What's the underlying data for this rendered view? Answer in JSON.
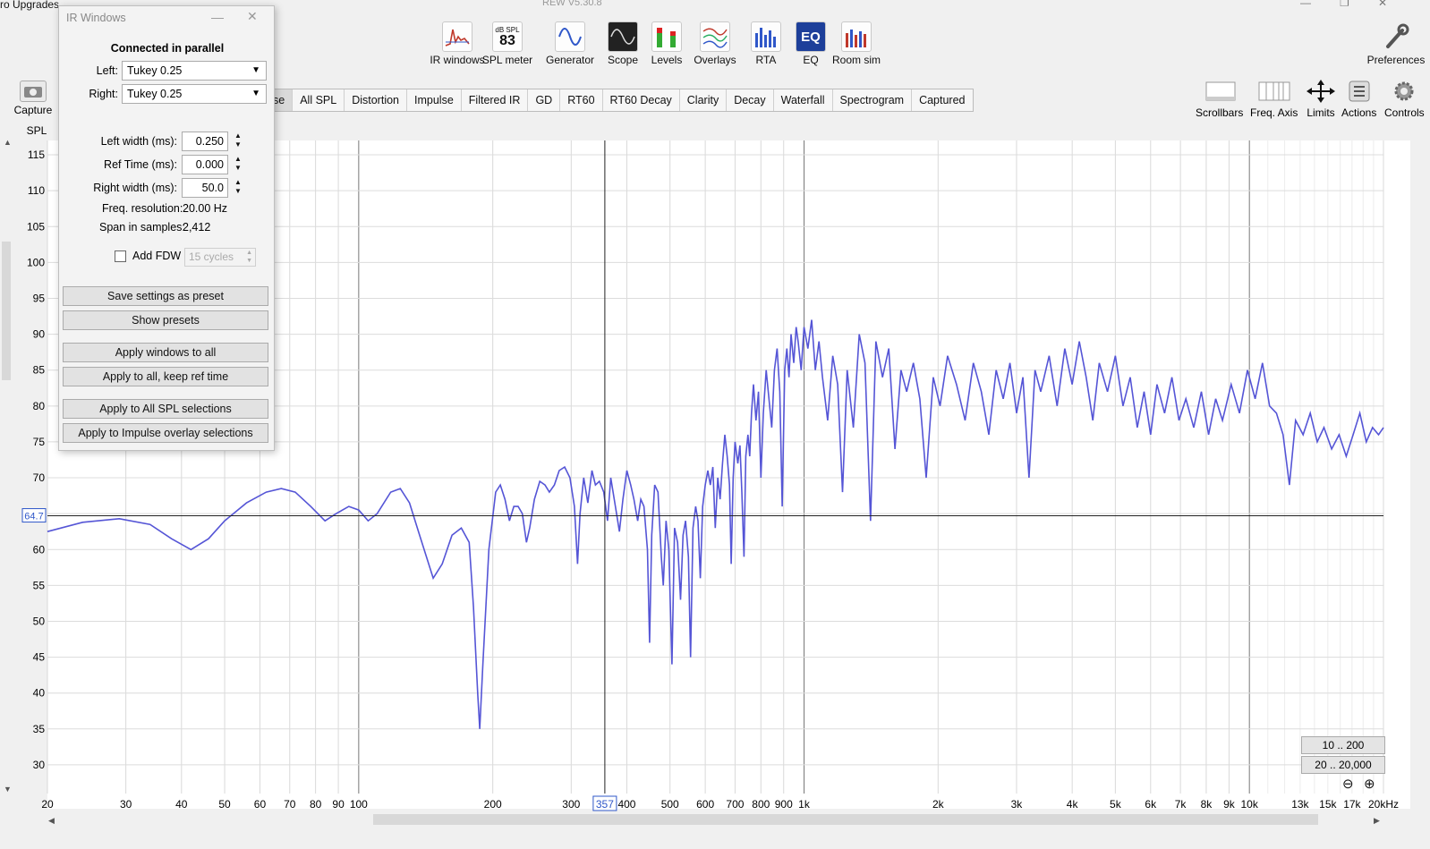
{
  "window": {
    "title": "ro Upgrades",
    "version": "REW V5.30.8",
    "controls": [
      "—",
      "❐",
      "✕"
    ]
  },
  "toolbar": [
    {
      "name": "ir-windows",
      "label": "IR windows",
      "icon": "ir-windows-icon"
    },
    {
      "name": "spl-meter",
      "label": "SPL meter",
      "icon": "spl-meter-icon",
      "meter_unit": "dB SPL",
      "meter_value": "83"
    },
    {
      "name": "generator",
      "label": "Generator",
      "icon": "generator-icon"
    },
    {
      "name": "scope",
      "label": "Scope",
      "icon": "scope-icon"
    },
    {
      "name": "levels",
      "label": "Levels",
      "icon": "levels-icon"
    },
    {
      "name": "overlays",
      "label": "Overlays",
      "icon": "overlays-icon"
    },
    {
      "name": "rta",
      "label": "RTA",
      "icon": "rta-icon"
    },
    {
      "name": "eq",
      "label": "EQ",
      "icon": "eq-icon"
    },
    {
      "name": "room-sim",
      "label": "Room sim",
      "icon": "room-sim-icon"
    },
    {
      "name": "preferences",
      "label": "Preferences",
      "icon": "wrench-icon"
    }
  ],
  "capture": {
    "label": "Capture"
  },
  "tabs": [
    {
      "label": "se",
      "active": true
    },
    {
      "label": "All SPL"
    },
    {
      "label": "Distortion"
    },
    {
      "label": "Impulse"
    },
    {
      "label": "Filtered IR"
    },
    {
      "label": "GD"
    },
    {
      "label": "RT60"
    },
    {
      "label": "RT60 Decay"
    },
    {
      "label": "Clarity"
    },
    {
      "label": "Decay"
    },
    {
      "label": "Waterfall"
    },
    {
      "label": "Spectrogram"
    },
    {
      "label": "Captured"
    }
  ],
  "graph_tools": [
    {
      "name": "scrollbars",
      "label": "Scrollbars"
    },
    {
      "name": "freq-axis",
      "label": "Freq. Axis"
    },
    {
      "name": "limits",
      "label": "Limits"
    },
    {
      "name": "actions",
      "label": "Actions"
    },
    {
      "name": "controls",
      "label": "Controls"
    }
  ],
  "ir_windows": {
    "title": "IR Windows",
    "mode": "Connected in parallel",
    "left_label": "Left:",
    "left_value": "Tukey 0.25",
    "right_label": "Right:",
    "right_value": "Tukey 0.25",
    "left_width_label": "Left width (ms):",
    "left_width": "0.250",
    "ref_time_label": "Ref Time (ms):",
    "ref_time": "0.000",
    "right_width_label": "Right width (ms):",
    "right_width": "50.0",
    "freq_res_label": "Freq. resolution:",
    "freq_res": "20.00 Hz",
    "span_label": "Span in samples:",
    "span": "2,412",
    "fdw_label": "Add FDW",
    "fdw_checked": false,
    "fdw_cycles": "15 cycles",
    "buttons": [
      "Save settings as preset",
      "Show presets",
      "Apply windows to all",
      "Apply to all, keep ref time",
      "Apply to All SPL selections",
      "Apply to Impulse overlay selections"
    ]
  },
  "range_buttons": [
    "10 .. 200",
    "20 .. 20,000"
  ],
  "chart_data": {
    "type": "line",
    "ylabel": "SPL",
    "xscale": "log",
    "xlim": [
      20,
      20000
    ],
    "ylim": [
      26,
      117
    ],
    "y_ticks": [
      30,
      35,
      40,
      45,
      50,
      55,
      60,
      65,
      70,
      75,
      80,
      85,
      90,
      95,
      100,
      105,
      110,
      115
    ],
    "x_ticks": [
      {
        "v": 20,
        "l": "20"
      },
      {
        "v": 30,
        "l": "30"
      },
      {
        "v": 40,
        "l": "40"
      },
      {
        "v": 50,
        "l": "50"
      },
      {
        "v": 60,
        "l": "60"
      },
      {
        "v": 70,
        "l": "70"
      },
      {
        "v": 80,
        "l": "80"
      },
      {
        "v": 90,
        "l": "90"
      },
      {
        "v": 100,
        "l": "100"
      },
      {
        "v": 200,
        "l": "200"
      },
      {
        "v": 300,
        "l": "300"
      },
      {
        "v": 400,
        "l": "400"
      },
      {
        "v": 500,
        "l": "500"
      },
      {
        "v": 600,
        "l": "600"
      },
      {
        "v": 700,
        "l": "700"
      },
      {
        "v": 800,
        "l": "800"
      },
      {
        "v": 900,
        "l": "900"
      },
      {
        "v": 1000,
        "l": "1k"
      },
      {
        "v": 2000,
        "l": "2k"
      },
      {
        "v": 3000,
        "l": "3k"
      },
      {
        "v": 4000,
        "l": "4k"
      },
      {
        "v": 5000,
        "l": "5k"
      },
      {
        "v": 6000,
        "l": "6k"
      },
      {
        "v": 7000,
        "l": "7k"
      },
      {
        "v": 8000,
        "l": "8k"
      },
      {
        "v": 9000,
        "l": "9k"
      },
      {
        "v": 10000,
        "l": "10k"
      },
      {
        "v": 13000,
        "l": "13k"
      },
      {
        "v": 15000,
        "l": "15k"
      },
      {
        "v": 17000,
        "l": "17k"
      },
      {
        "v": 20000,
        "l": "20kHz"
      }
    ],
    "cursor": {
      "freq": 357,
      "freq_label": "357",
      "spl": 64.7,
      "spl_label": "64.7"
    },
    "line_color": "#5555d6",
    "series": [
      {
        "points": [
          [
            20,
            62.5
          ],
          [
            24,
            63.8
          ],
          [
            29,
            64.3
          ],
          [
            34,
            63.5
          ],
          [
            38,
            61.5
          ],
          [
            42,
            60
          ],
          [
            46,
            61.5
          ],
          [
            50,
            64
          ],
          [
            56,
            66.5
          ],
          [
            62,
            68
          ],
          [
            67,
            68.5
          ],
          [
            72,
            68
          ],
          [
            78,
            66
          ],
          [
            84,
            64
          ],
          [
            89,
            65
          ],
          [
            95,
            66
          ],
          [
            100,
            65.5
          ],
          [
            105,
            64
          ],
          [
            110,
            65
          ],
          [
            118,
            68
          ],
          [
            124,
            68.5
          ],
          [
            130,
            66.5
          ],
          [
            137,
            62
          ],
          [
            147,
            56
          ],
          [
            154,
            58
          ],
          [
            162,
            62
          ],
          [
            170,
            63
          ],
          [
            177,
            61
          ],
          [
            181,
            52
          ],
          [
            185,
            40
          ],
          [
            187,
            35
          ],
          [
            190,
            44
          ],
          [
            196,
            60
          ],
          [
            203,
            68
          ],
          [
            208,
            69
          ],
          [
            213,
            67
          ],
          [
            218,
            64
          ],
          [
            223,
            66
          ],
          [
            228,
            66
          ],
          [
            233,
            65
          ],
          [
            238,
            61
          ],
          [
            242,
            63
          ],
          [
            248,
            67
          ],
          [
            255,
            69.5
          ],
          [
            262,
            69
          ],
          [
            268,
            68
          ],
          [
            275,
            69
          ],
          [
            282,
            71
          ],
          [
            290,
            71.5
          ],
          [
            298,
            70
          ],
          [
            305,
            66
          ],
          [
            310,
            58
          ],
          [
            314,
            65
          ],
          [
            320,
            70
          ],
          [
            327,
            66.5
          ],
          [
            334,
            71
          ],
          [
            340,
            69
          ],
          [
            347,
            69.5
          ],
          [
            355,
            68
          ],
          [
            362,
            64
          ],
          [
            368,
            70
          ],
          [
            377,
            66
          ],
          [
            385,
            62.5
          ],
          [
            392,
            67
          ],
          [
            400,
            71
          ],
          [
            408,
            69
          ],
          [
            415,
            67
          ],
          [
            423,
            64
          ],
          [
            430,
            67
          ],
          [
            437,
            66
          ],
          [
            445,
            60
          ],
          [
            450,
            47
          ],
          [
            455,
            62
          ],
          [
            462,
            69
          ],
          [
            470,
            68
          ],
          [
            478,
            59
          ],
          [
            483,
            55
          ],
          [
            490,
            64
          ],
          [
            497,
            60
          ],
          [
            505,
            44
          ],
          [
            512,
            63
          ],
          [
            520,
            61
          ],
          [
            528,
            53
          ],
          [
            535,
            62
          ],
          [
            542,
            64
          ],
          [
            550,
            59
          ],
          [
            556,
            45
          ],
          [
            563,
            63
          ],
          [
            571,
            66
          ],
          [
            578,
            64
          ],
          [
            585,
            56
          ],
          [
            592,
            66
          ],
          [
            600,
            69
          ],
          [
            608,
            71
          ],
          [
            616,
            69
          ],
          [
            624,
            71.5
          ],
          [
            632,
            63
          ],
          [
            640,
            70
          ],
          [
            648,
            67
          ],
          [
            656,
            72
          ],
          [
            664,
            76
          ],
          [
            672,
            73
          ],
          [
            680,
            69
          ],
          [
            686,
            58
          ],
          [
            693,
            70
          ],
          [
            700,
            75
          ],
          [
            710,
            72
          ],
          [
            718,
            74.5
          ],
          [
            725,
            68
          ],
          [
            733,
            59
          ],
          [
            740,
            73
          ],
          [
            748,
            76
          ],
          [
            755,
            73
          ],
          [
            762,
            79
          ],
          [
            770,
            83
          ],
          [
            780,
            78
          ],
          [
            790,
            82
          ],
          [
            800,
            70
          ],
          [
            810,
            79
          ],
          [
            822,
            85
          ],
          [
            834,
            81
          ],
          [
            846,
            77
          ],
          [
            858,
            85
          ],
          [
            870,
            88
          ],
          [
            882,
            82
          ],
          [
            893,
            66
          ],
          [
            905,
            85
          ],
          [
            915,
            88
          ],
          [
            925,
            84
          ],
          [
            935,
            90
          ],
          [
            948,
            86
          ],
          [
            960,
            91
          ],
          [
            970,
            89
          ],
          [
            985,
            85
          ],
          [
            1000,
            91
          ],
          [
            1020,
            88
          ],
          [
            1040,
            92
          ],
          [
            1060,
            85
          ],
          [
            1080,
            89
          ],
          [
            1100,
            84
          ],
          [
            1130,
            78
          ],
          [
            1160,
            87
          ],
          [
            1190,
            83
          ],
          [
            1220,
            68
          ],
          [
            1250,
            85
          ],
          [
            1290,
            77
          ],
          [
            1330,
            90
          ],
          [
            1370,
            86
          ],
          [
            1410,
            64
          ],
          [
            1450,
            89
          ],
          [
            1500,
            84
          ],
          [
            1550,
            88
          ],
          [
            1600,
            74
          ],
          [
            1650,
            85
          ],
          [
            1700,
            82
          ],
          [
            1760,
            86
          ],
          [
            1820,
            81
          ],
          [
            1880,
            70
          ],
          [
            1950,
            84
          ],
          [
            2020,
            80
          ],
          [
            2100,
            87
          ],
          [
            2200,
            83
          ],
          [
            2300,
            78
          ],
          [
            2400,
            86
          ],
          [
            2500,
            82
          ],
          [
            2600,
            76
          ],
          [
            2700,
            85
          ],
          [
            2800,
            81
          ],
          [
            2900,
            86
          ],
          [
            3000,
            79
          ],
          [
            3100,
            84
          ],
          [
            3200,
            70
          ],
          [
            3300,
            85
          ],
          [
            3400,
            82
          ],
          [
            3550,
            87
          ],
          [
            3700,
            80
          ],
          [
            3850,
            88
          ],
          [
            4000,
            83
          ],
          [
            4150,
            89
          ],
          [
            4300,
            84
          ],
          [
            4450,
            78
          ],
          [
            4600,
            86
          ],
          [
            4800,
            82
          ],
          [
            5000,
            87
          ],
          [
            5200,
            80
          ],
          [
            5400,
            84
          ],
          [
            5600,
            77
          ],
          [
            5800,
            82
          ],
          [
            6000,
            76
          ],
          [
            6200,
            83
          ],
          [
            6450,
            79
          ],
          [
            6700,
            84
          ],
          [
            6950,
            78
          ],
          [
            7200,
            81
          ],
          [
            7500,
            77
          ],
          [
            7800,
            82
          ],
          [
            8100,
            76
          ],
          [
            8400,
            81
          ],
          [
            8700,
            78
          ],
          [
            9100,
            83
          ],
          [
            9500,
            79
          ],
          [
            9900,
            85
          ],
          [
            10300,
            81
          ],
          [
            10700,
            86
          ],
          [
            11100,
            80
          ],
          [
            11500,
            79
          ],
          [
            11900,
            76
          ],
          [
            12300,
            69
          ],
          [
            12700,
            78
          ],
          [
            13200,
            76
          ],
          [
            13700,
            79
          ],
          [
            14200,
            75
          ],
          [
            14700,
            77
          ],
          [
            15300,
            74
          ],
          [
            15900,
            76
          ],
          [
            16500,
            73
          ],
          [
            17100,
            76
          ],
          [
            17700,
            79
          ],
          [
            18300,
            75
          ],
          [
            18900,
            77
          ],
          [
            19500,
            76
          ],
          [
            20000,
            77
          ]
        ]
      }
    ]
  }
}
